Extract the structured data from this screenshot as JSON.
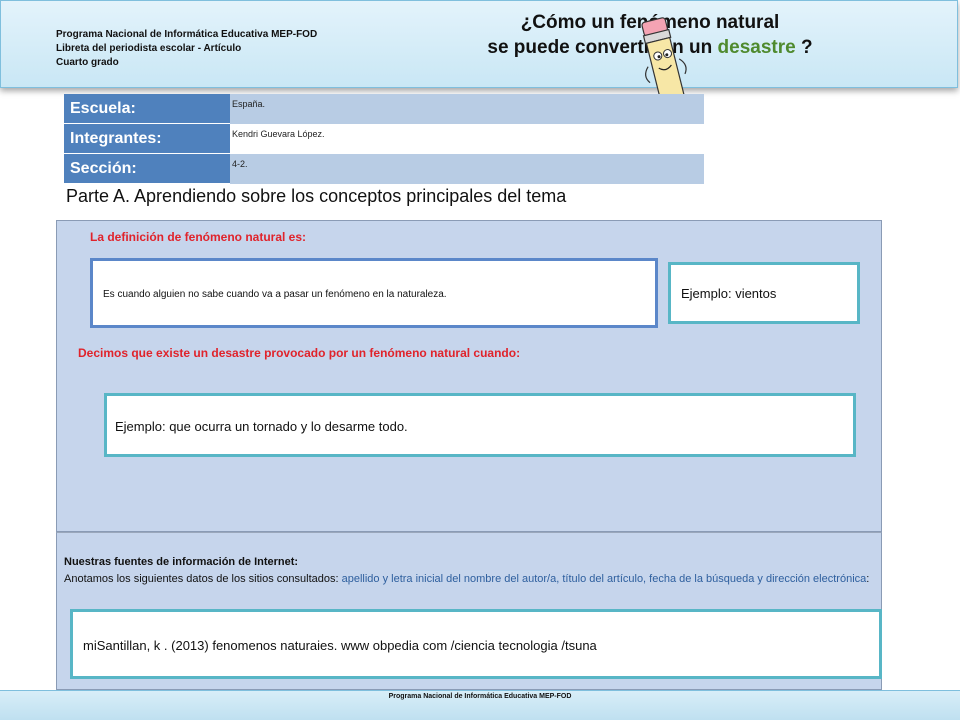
{
  "header": {
    "org_line1": "Programa Nacional de Informática Educativa MEP-FOD",
    "org_line2": "Libreta del periodista escolar - Artículo",
    "org_line3": "Cuarto grado",
    "title_line1": "¿Cómo un fenómeno natural",
    "title_line2_start": "se puede convertir en un ",
    "title_line2_accent": "desastre",
    "title_line2_end": " ?",
    "accent_color": "#4f8a2e"
  },
  "info": {
    "school_label": "Escuela:",
    "school_value": "España.",
    "members_label": "Integrantes:",
    "members_value": "Kendri    Guevara López.",
    "section_label": "Sección:",
    "section_value": "4-2."
  },
  "part_a_heading": "Parte A.  Aprendiendo sobre los conceptos principales del tema",
  "definition": {
    "label": "La definición de  fenómeno natural es:",
    "answer": "Es  cuando    alguien  no  sabe  cuando    va   a  pasar un fenómeno en la  naturaleza.",
    "example": "Ejemplo: vientos"
  },
  "disaster": {
    "label": "Decimos que existe un desastre provocado por un fenómeno natural cuando:",
    "example": "Ejemplo: que ocurra un tornado y lo desarme todo."
  },
  "sources": {
    "title": "Nuestras fuentes de información de Internet:",
    "desc_start": "Anotamos los siguientes datos de los sitios consultados: ",
    "desc_blue": "apellido y letra inicial del nombre del autor/a,  título del artículo, fecha de la búsqueda y dirección electrónica",
    "desc_end": ":",
    "entry": "miSantillan,  k . (2013)   fenomenos    naturaies. www  obpedia  com /ciencia tecnologia  /tsuna"
  },
  "footer": {
    "text": "Programa  Nacional de Informática  Educativa MEP-FOD"
  },
  "colors": {
    "label_blue": "#4f81bd",
    "panel_blue": "#c6d5ec",
    "red_label": "#e0232b",
    "box_border_blue": "#5b87c9",
    "box_border_teal": "#58b6c6"
  }
}
